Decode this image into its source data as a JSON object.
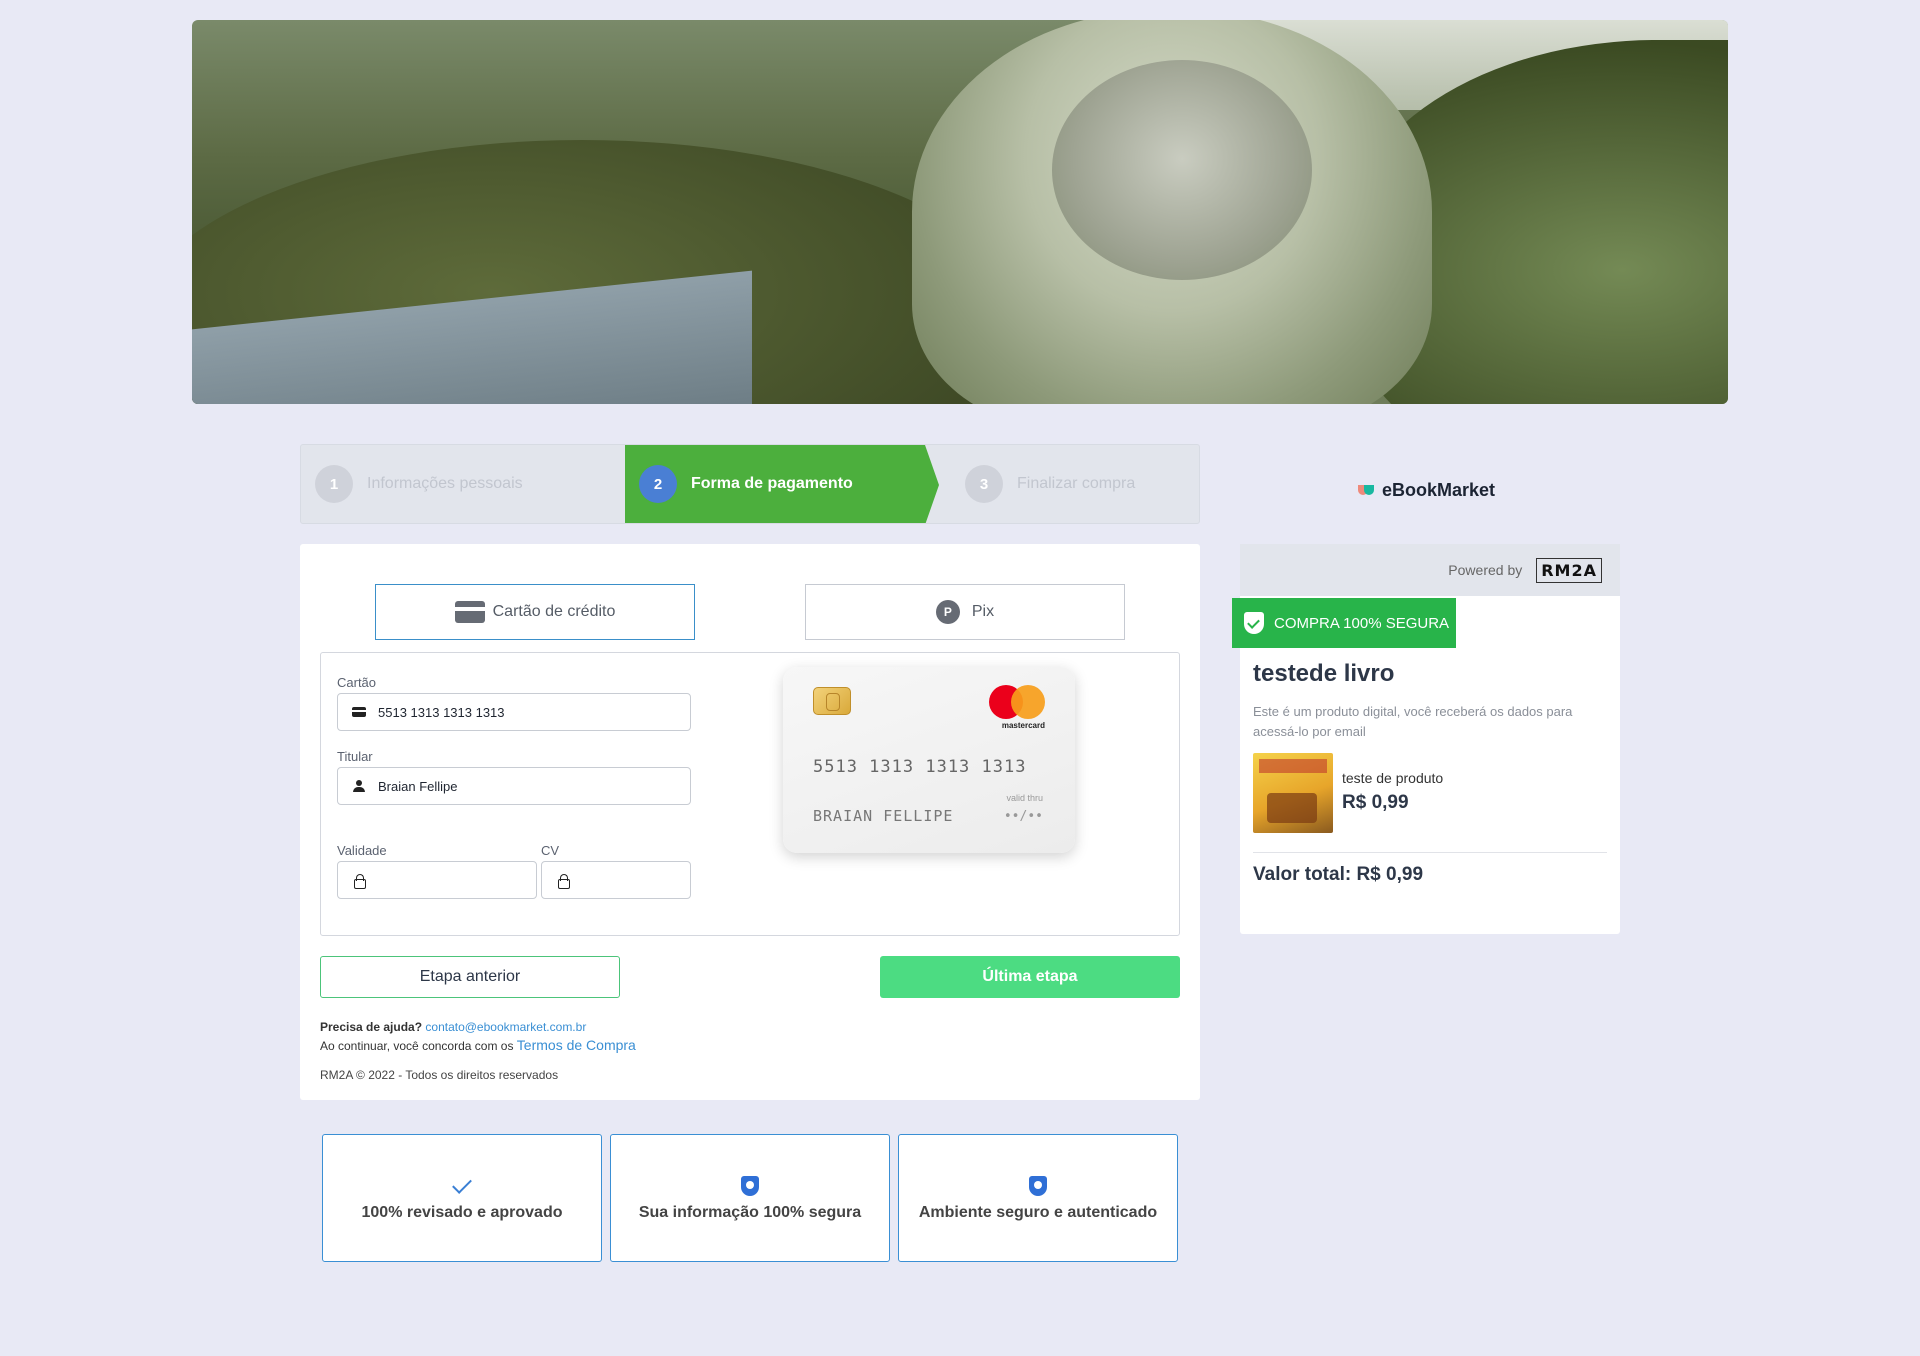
{
  "stepper": {
    "steps": [
      {
        "num": "1",
        "label": "Informações pessoais"
      },
      {
        "num": "2",
        "label": "Forma de pagamento"
      },
      {
        "num": "3",
        "label": "Finalizar compra"
      }
    ]
  },
  "payment": {
    "tabs": [
      {
        "label": "Cartão de crédito",
        "icon": "credit-card-icon"
      },
      {
        "label": "Pix",
        "icon": "pix-icon"
      }
    ],
    "fields": {
      "card_label": "Cartão",
      "card_value": "5513 1313 1313 1313",
      "holder_label": "Titular",
      "holder_value": "Braian Fellipe",
      "validity_label": "Validade",
      "validity_value": "",
      "cv_label": "CV",
      "cv_value": ""
    },
    "preview": {
      "number": "5513 1313 1313 1313",
      "holder": "BRAIAN FELLIPE",
      "valid_label": "valid thru",
      "valid_value": "••/••",
      "brand": "mastercard"
    },
    "buttons": {
      "prev": "Etapa anterior",
      "next": "Última etapa"
    },
    "help": {
      "question": "Precisa de ajuda?",
      "email": "contato@ebookmarket.com.br",
      "terms_prefix": "Ao continuar, você concorda com os",
      "terms_link": "Termos de Compra"
    },
    "copyright": "RM2A © 2022 - Todos os direitos reservados"
  },
  "features": [
    {
      "label": "100% revisado e aprovado",
      "icon": "check-icon"
    },
    {
      "label": "Sua informação 100% segura",
      "icon": "shield-icon"
    },
    {
      "label": "Ambiente seguro e autenticado",
      "icon": "shield-lock-icon"
    }
  ],
  "sidebar": {
    "brand": "eBookMarket",
    "powered_by": "Powered by",
    "powered_logo": "RM2A",
    "secure_badge": "COMPRA 100% SEGURA",
    "product_title": "testede livro",
    "product_desc": "Este é um produto digital, você receberá os dados para acessá-lo por email",
    "item_name": "teste de produto",
    "item_price": "R$ 0,99",
    "total": "Valor total: R$ 0,99"
  },
  "colors": {
    "background": "#e8e9f5",
    "step_active": "#4caf3d",
    "step_num_active": "#4a7fd4",
    "next_button": "#4cdc82",
    "secure_badge": "#28b44a",
    "link": "#3a8fd4"
  }
}
